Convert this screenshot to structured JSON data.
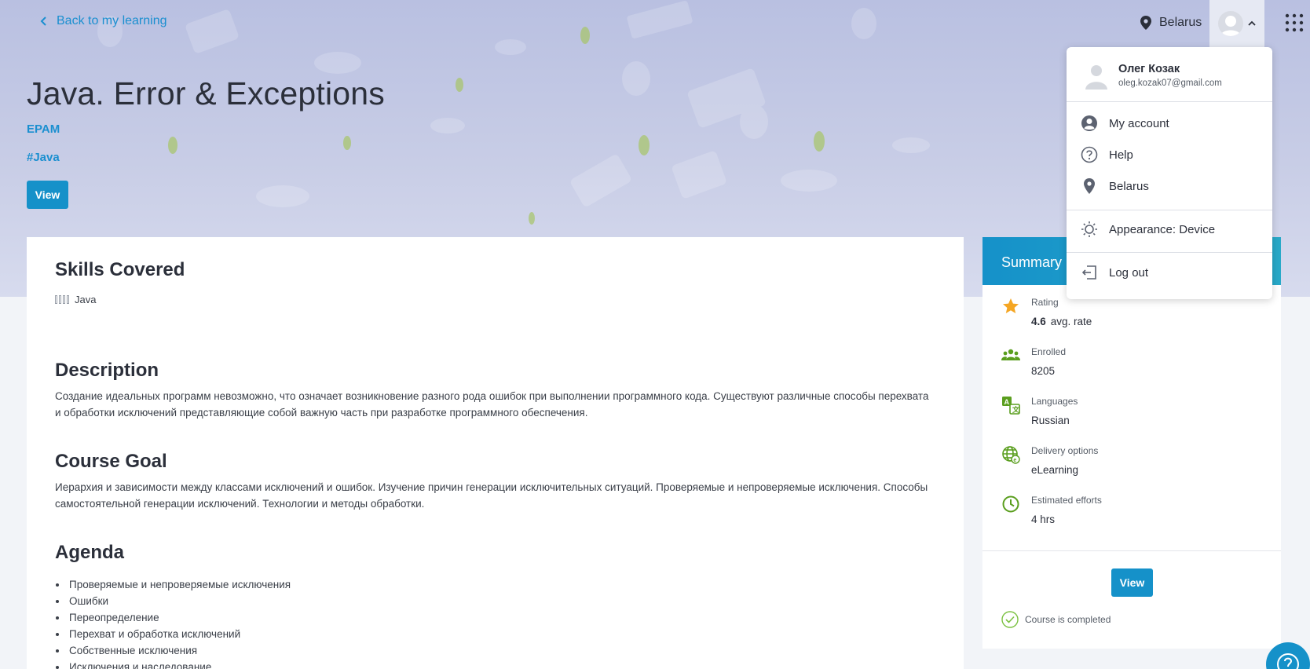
{
  "header": {
    "back_link": "Back to my learning",
    "location": "Belarus"
  },
  "course": {
    "title": "Java. Error & Exceptions",
    "provider": "EPAM",
    "tag": "#Java",
    "view_label": "View"
  },
  "main": {
    "skills_title": "Skills Covered",
    "skill": "Java",
    "description_title": "Description",
    "description": "Создание идеальных программ невозможно, что означает возникновение разного рода ошибок при выполнении программного кода. Существуют различные способы перехвата и обработки исключений представляющие собой важную часть при разработке программного обеспечения.",
    "goal_title": "Course Goal",
    "goal": "Иерархия и зависимости между классами исключений и ошибок. Изучение причин генерации исключительных ситуаций. Проверяемые и непроверяемые исключения. Способы самостоятельной генерации исключений. Технологии и методы обработки.",
    "agenda_title": "Agenda",
    "agenda": [
      "Проверяемые и непроверяемые исключения",
      "Ошибки",
      "Переопределение",
      "Перехват и обработка исключений",
      "Собственные исключения",
      "Исключения и наследование"
    ]
  },
  "summary": {
    "title": "Summary",
    "rating_label": "Rating",
    "rating_value": "4.6",
    "rating_suffix": "avg. rate",
    "enrolled_label": "Enrolled",
    "enrolled_value": "8205",
    "languages_label": "Languages",
    "languages_value": "Russian",
    "delivery_label": "Delivery options",
    "delivery_value": "eLearning",
    "efforts_label": "Estimated efforts",
    "efforts_value": "4 hrs",
    "view_label": "View",
    "completed_text": "Course is completed"
  },
  "user_menu": {
    "name": "Олег Козак",
    "email": "oleg.kozak07@gmail.com",
    "my_account": "My account",
    "help": "Help",
    "location": "Belarus",
    "appearance": "Appearance: Device",
    "logout": "Log out"
  },
  "colors": {
    "accent": "#1591c9",
    "link": "#1a8fd0",
    "green_icon": "#5a9e1e",
    "star": "#f5a623"
  }
}
